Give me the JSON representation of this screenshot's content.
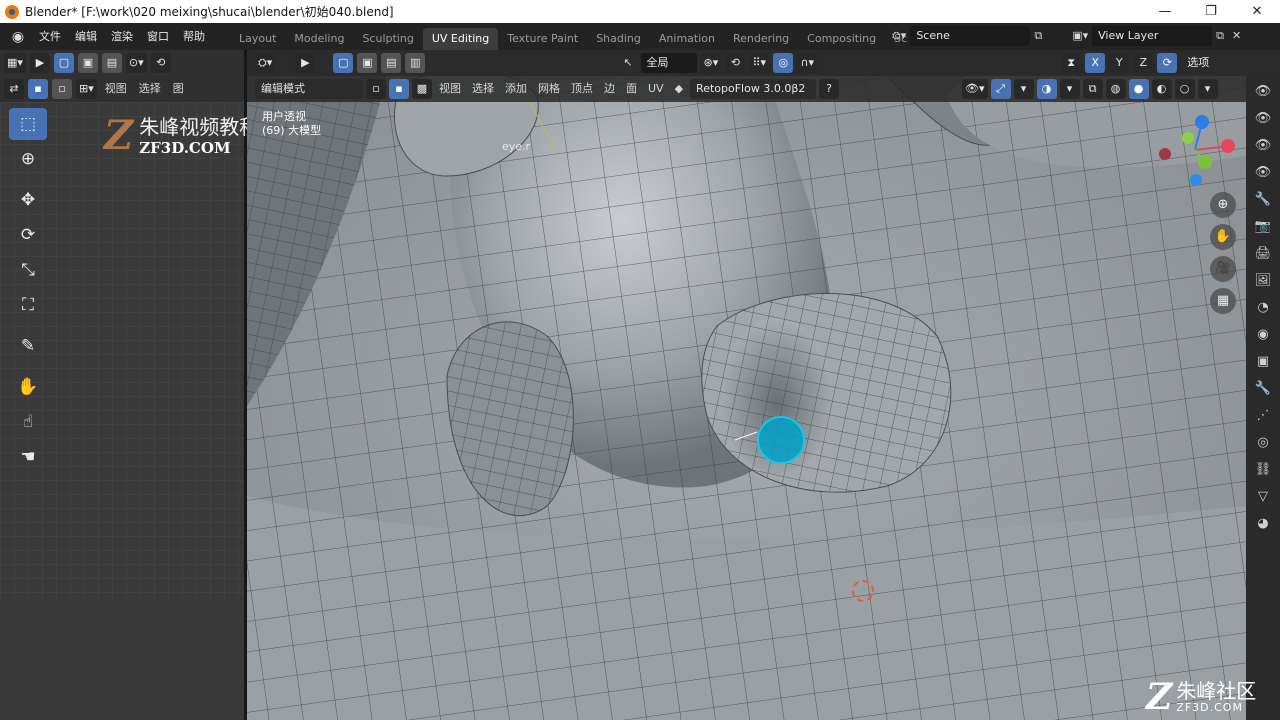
{
  "window": {
    "title": "Blender* [F:\\work\\020 meixing\\shucai\\blender\\初始040.blend]",
    "minimize": "—",
    "maximize": "❐",
    "close": "✕"
  },
  "menu": {
    "items": [
      "文件",
      "编辑",
      "渲染",
      "窗口",
      "帮助"
    ]
  },
  "workspaces": {
    "tabs": [
      "Layout",
      "Modeling",
      "Sculpting",
      "UV Editing",
      "Texture Paint",
      "Shading",
      "Animation",
      "Rendering",
      "Compositing",
      "Sc"
    ],
    "active": "UV Editing"
  },
  "scene": {
    "name": "Scene",
    "view_layer": "View Layer"
  },
  "uv_editor": {
    "menu": [
      "视图",
      "选择",
      "图"
    ]
  },
  "viewport": {
    "mode": "编辑模式",
    "menu": [
      "视图",
      "选择",
      "添加",
      "网格",
      "顶点",
      "边",
      "面",
      "UV"
    ],
    "orientation": "全局",
    "addon": "RetopoFlow 3.0.0β2",
    "options_label": "选项",
    "axes": [
      "X",
      "Y",
      "Z"
    ],
    "overlay_line1": "用户透视",
    "overlay_line2": "(69) 大模型",
    "object_label": "eye.r"
  },
  "watermarks": {
    "top_cn": "朱峰视频教程社区",
    "top_en": "ZF3D.COM",
    "bottom_cn": "朱峰社区",
    "bottom_en": "ZF3D.COM"
  },
  "colors": {
    "active_blue": "#4772b3",
    "brush": "#18c6e8",
    "cursor": "#e85b3a"
  }
}
